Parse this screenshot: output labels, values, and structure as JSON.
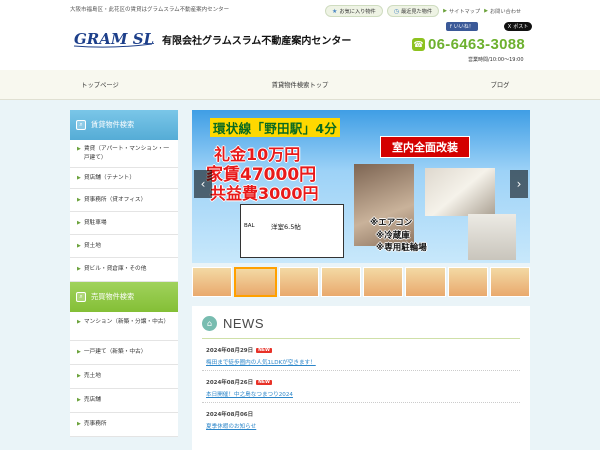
{
  "header": {
    "tagline": "大阪市福島区・此花区の賃貸はグラムスラム不動産案内センター",
    "logo_text": "GRAM SLAM",
    "logo_kana": "グラム スラム",
    "company_name": "有限会社グラムスラム不動産案内センター",
    "favorites_label": "お気に入り物件",
    "recent_label": "最近見た物件",
    "sitemap_label": "サイトマップ",
    "contact_label": "お問い合わせ",
    "facebook_label": "いいね！",
    "x_label": "ポスト",
    "phone": "06-6463-3088",
    "hours": "営業時間/10:00～19:00"
  },
  "nav": [
    {
      "label": "トップページ"
    },
    {
      "label": "賃貸物件検索トップ"
    },
    {
      "label": "ブログ"
    }
  ],
  "sidebar": {
    "rent_title": "賃貸物件検索",
    "rent_items": [
      {
        "label": "賃貸（アパート・マンション・一戸建て）"
      },
      {
        "label": "貸店舗（テナント）"
      },
      {
        "label": "貸事務所（貸オフィス）"
      },
      {
        "label": "貸駐車場"
      },
      {
        "label": "貸土地"
      },
      {
        "label": "貸ビル・貸倉庫・その他"
      }
    ],
    "sale_title": "売買物件検索",
    "sale_items": [
      {
        "label": "マンション（新築・分譲・中古）"
      },
      {
        "label": "一戸建て（新築・中古）"
      },
      {
        "label": "売土地"
      },
      {
        "label": "売店舗"
      },
      {
        "label": "売事務所"
      }
    ]
  },
  "slider": {
    "title": "環状線「野田駅」4分",
    "line1": "礼金10万円",
    "line2": "家賃47000円",
    "line3": "共益費3000円",
    "renovated": "室内全面改装",
    "room": "洋室6.5帖",
    "bal": "BAL",
    "amenity1": "※エアコン",
    "amenity2": "※冷蔵庫",
    "amenity3": "※専用駐輪場",
    "prev": "‹",
    "next": "›"
  },
  "news": {
    "title": "NEWS",
    "new_badge": "NEW",
    "items": [
      {
        "date": "2024年08月29日",
        "is_new": true,
        "text": "梅田まで徒歩圏内の人気1LDKが空きます！"
      },
      {
        "date": "2024年08月26日",
        "is_new": true,
        "text": "本日開催！中之島なつまつり2024"
      },
      {
        "date": "2024年08月06日",
        "is_new": false,
        "text": "夏季休暇のお知らせ"
      }
    ]
  },
  "colors": {
    "accent_green": "#8dc21f",
    "sidebar_blue": "#55acd6",
    "link_blue": "#2c86c9",
    "badge_red": "#e83228"
  }
}
